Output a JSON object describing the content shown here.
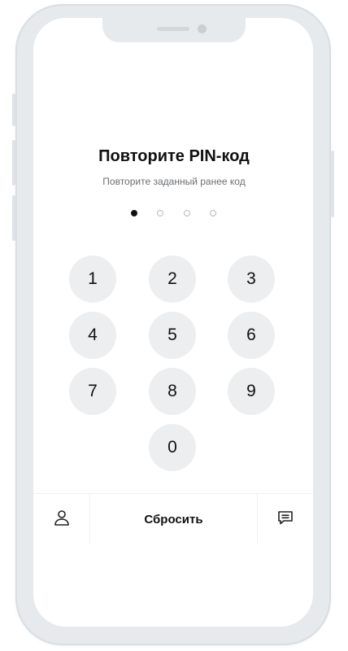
{
  "header": {
    "title": "Повторите PIN-код",
    "subtitle": "Повторите заданный ранее код"
  },
  "pin": {
    "length": 4,
    "entered": 1
  },
  "keypad": {
    "keys": [
      "1",
      "2",
      "3",
      "4",
      "5",
      "6",
      "7",
      "8",
      "9",
      "0"
    ]
  },
  "footer": {
    "reset_label": "Сбросить",
    "left_icon": "user-icon",
    "right_icon": "chat-icon"
  },
  "colors": {
    "text": "#111111",
    "key_background": "#eceef0",
    "frame": "#e6eaed"
  }
}
